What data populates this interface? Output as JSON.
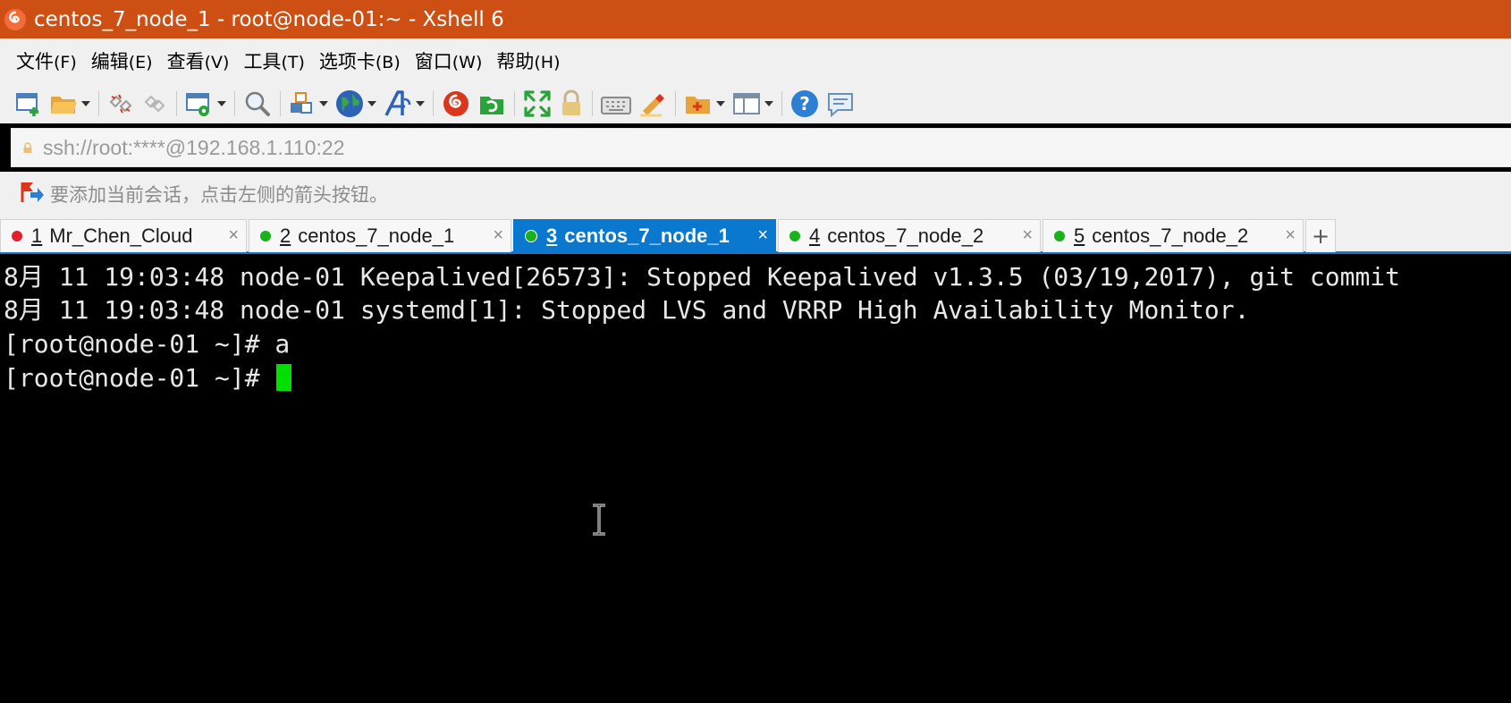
{
  "window": {
    "title": "centos_7_node_1 - root@node-01:~ - Xshell 6"
  },
  "menu": {
    "items": [
      {
        "label": "文件",
        "accel": "(F)"
      },
      {
        "label": "编辑",
        "accel": "(E)"
      },
      {
        "label": "查看",
        "accel": "(V)"
      },
      {
        "label": "工具",
        "accel": "(T)"
      },
      {
        "label": "选项卡",
        "accel": "(B)"
      },
      {
        "label": "窗口",
        "accel": "(W)"
      },
      {
        "label": "帮助",
        "accel": "(H)"
      }
    ]
  },
  "toolbar": {
    "icons": [
      "new-session-icon",
      "open-folder-icon",
      "disconnect-icon",
      "reconnect-icon",
      "properties-gear-icon",
      "find-icon",
      "transfer-icon",
      "globe-icon",
      "font-icon",
      "xshell-logo-icon",
      "xftp-icon",
      "fullscreen-icon",
      "lock-icon",
      "keyboard-icon",
      "highlight-icon",
      "new-folder-icon",
      "layout-icon",
      "help-icon",
      "chat-icon"
    ],
    "colors": {
      "accent_blue": "#0b78d0",
      "orange": "#e08a1e",
      "red": "#d9361c",
      "green": "#2aa33b"
    }
  },
  "address": {
    "value": "ssh://root:****@192.168.1.110:22"
  },
  "hint": {
    "text": "要添加当前会话，点击左侧的箭头按钮。"
  },
  "tabs": [
    {
      "num": "1",
      "label": "Mr_Chen_Cloud",
      "status_color": "#e0202a",
      "active": false
    },
    {
      "num": "2",
      "label": "centos_7_node_1",
      "status_color": "#19b21c",
      "active": false
    },
    {
      "num": "3",
      "label": "centos_7_node_1",
      "status_color": "#19b21c",
      "active": true
    },
    {
      "num": "4",
      "label": "centos_7_node_2",
      "status_color": "#19b21c",
      "active": false
    },
    {
      "num": "5",
      "label": "centos_7_node_2",
      "status_color": "#19b21c",
      "active": false
    }
  ],
  "tab_close": "×",
  "tab_add": "+",
  "terminal": {
    "lines": [
      "8月 11 19:03:48 node-01 Keepalived[26573]: Stopped Keepalived v1.3.5 (03/19,2017), git commit",
      "8月 11 19:03:48 node-01 systemd[1]: Stopped LVS and VRRP High Availability Monitor.",
      "[root@node-01 ~]# a",
      "[root@node-01 ~]# "
    ],
    "cursor_color": "#00e000"
  }
}
